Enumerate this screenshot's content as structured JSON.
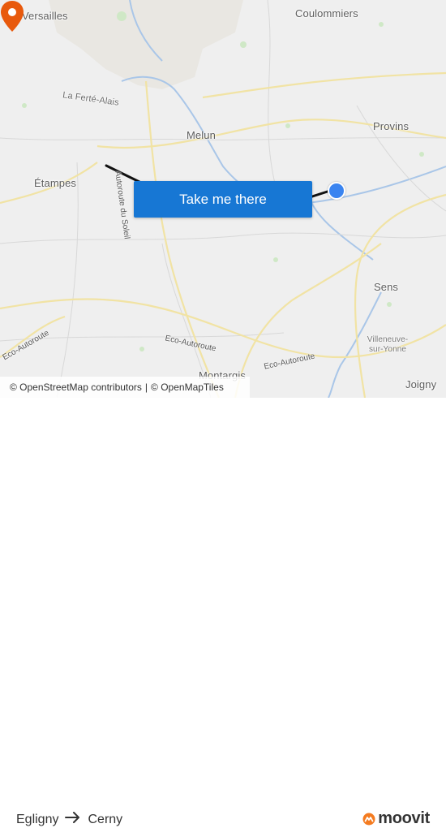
{
  "map": {
    "places": {
      "versailles": "Versailles",
      "coulommiers": "Coulommiers",
      "la_ferte_alais": "La Ferté-Alais",
      "melun": "Melun",
      "provins": "Provins",
      "etampes": "Étampes",
      "sens": "Sens",
      "villeneuve": "Villeneuve-sur-Yonne",
      "joigny": "Joigny",
      "montargis": "Montargis"
    },
    "roads": {
      "autoroute_soleil": "Autoroute du Soleil",
      "eco_autoroute_1": "Eco-Autoroute",
      "eco_autoroute_2": "Eco-Autoroute",
      "eco_autoroute_3": "Eco-Autoroute"
    },
    "colors": {
      "route_line": "#111111",
      "origin_pin": "#e8590c",
      "destination_dot": "#3a84f0",
      "button": "#1777d4"
    }
  },
  "cta": {
    "label": "Take me there"
  },
  "attribution": {
    "osm": "© OpenStreetMap contributors",
    "separator": "|",
    "omt": "© OpenMapTiles"
  },
  "route": {
    "from": "Egligny",
    "to": "Cerny"
  },
  "brand": {
    "name": "moovit",
    "icon": "moovit-logo-icon"
  }
}
